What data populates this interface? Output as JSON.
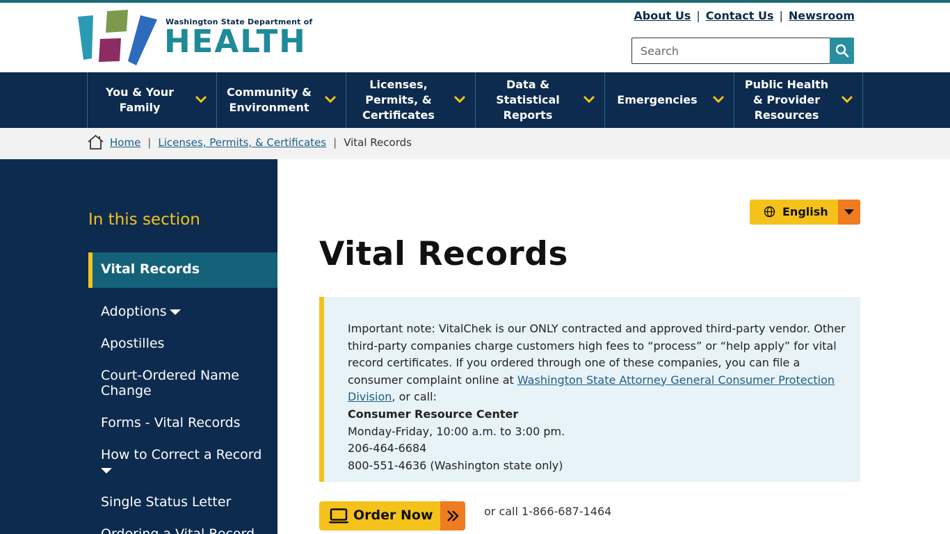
{
  "header": {
    "logo_tagline": "Washington State Department of",
    "logo_wordmark": "HEALTH",
    "top_links": [
      "About Us",
      "Contact Us",
      "Newsroom"
    ],
    "search_placeholder": "Search"
  },
  "nav": {
    "items": [
      "You & Your Family",
      "Community & Environment",
      "Licenses, Permits, & Certificates",
      "Data & Statistical Reports",
      "Emergencies",
      "Public Health & Provider Resources"
    ]
  },
  "breadcrumb": {
    "home": "Home",
    "section": "Licenses, Permits, & Certificates",
    "current": "Vital Records",
    "separator": "|"
  },
  "sidebar": {
    "title": "In this section",
    "active": "Vital Records",
    "links": [
      "Adoptions",
      "Apostilles",
      "Court-Ordered Name Change",
      "Forms - Vital Records",
      "How to Correct a Record",
      "Single Status Letter",
      "Ordering a Vital Record"
    ]
  },
  "language": {
    "label": "English"
  },
  "page": {
    "title": "Vital Records",
    "note": {
      "intro": "Important note: VitalChek is our ONLY contracted and approved third-party vendor. Other third-party companies charge customers high fees to “process” or “help apply” for vital record certificates. If you ordered through one of these companies, you can file a consumer complaint online at ",
      "link": "Washington State Attorney General Consumer Protection Division",
      "after_link": ", or call:",
      "center_name": "Consumer Resource Center",
      "hours": "Monday-Friday, 10:00 a.m. to 3:00 pm.",
      "phone1": "206-464-6684",
      "phone2": "800-551-4636 (Washington state only)"
    },
    "order_button": "Order Now",
    "or_call": "or call 1-866-687-1464"
  },
  "colors": {
    "navy": "#0c2b4e",
    "teal": "#1f8a99",
    "yellow": "#f5c21b",
    "orange": "#f07c21",
    "note_bg": "#e8f3f8"
  }
}
